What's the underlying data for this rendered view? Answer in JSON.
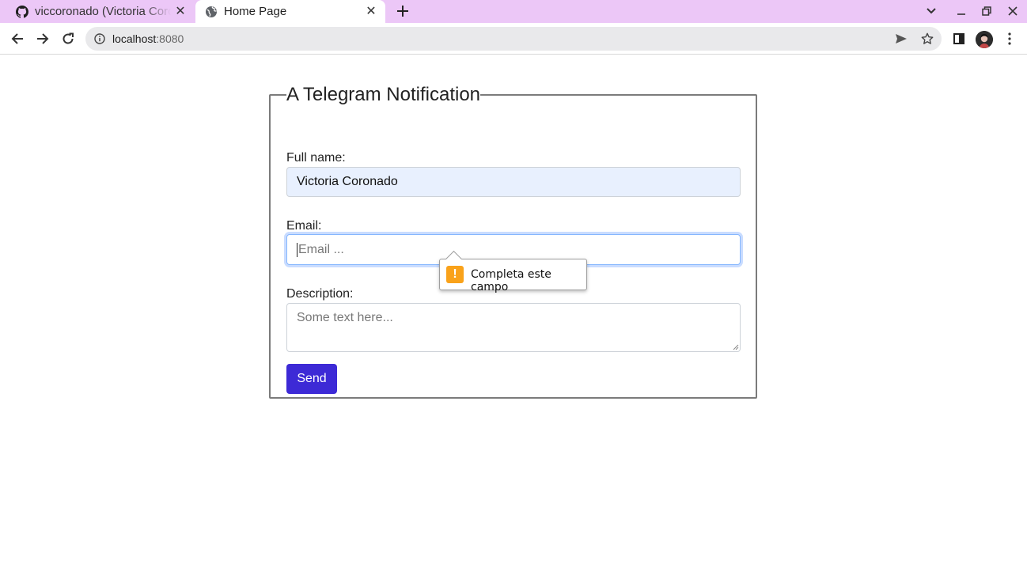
{
  "browser": {
    "tabs": [
      {
        "title": "viccoronado (Victoria Coronado)",
        "icon": "github-icon",
        "active": false
      },
      {
        "title": "Home Page",
        "icon": "globe-icon",
        "active": true
      }
    ],
    "address": {
      "host": "localhost",
      "port": ":8080"
    }
  },
  "form": {
    "legend": "A Telegram Notification",
    "name_label": "Full name:",
    "name_value": "Victoria Coronado",
    "email_label": "Email:",
    "email_placeholder": "Email ...",
    "description_label": "Description:",
    "description_placeholder": "Some text here...",
    "send_label": "Send"
  },
  "validation": {
    "message": "Completa este campo"
  },
  "colors": {
    "tabstrip": "#ecc7f7",
    "send_button": "#3d2ad6",
    "autofill": "#e8f0fe",
    "warning": "#f9a21a"
  }
}
